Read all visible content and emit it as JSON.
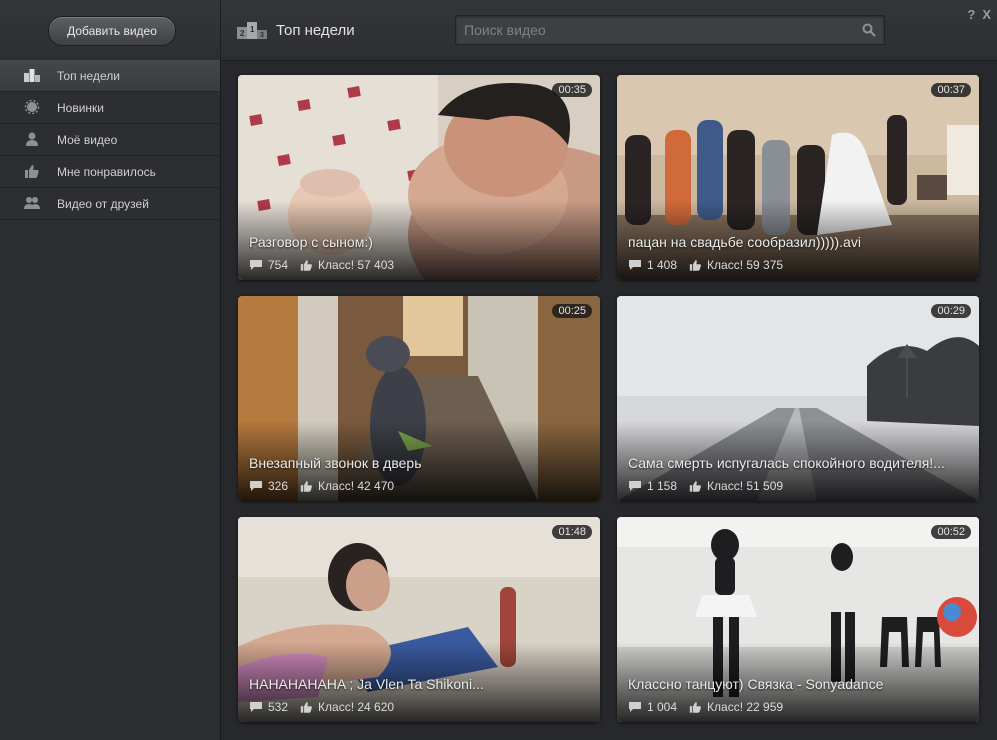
{
  "toolbar": {
    "add_video_label": "Добавить видео",
    "section_title": "Топ недели",
    "search_placeholder": "Поиск видео",
    "help_label": "?",
    "close_label": "X"
  },
  "sidebar": {
    "items": [
      {
        "label": "Топ недели",
        "icon": "podium-icon"
      },
      {
        "label": "Новинки",
        "icon": "gear-icon"
      },
      {
        "label": "Моё видео",
        "icon": "person-icon"
      },
      {
        "label": "Мне понравилось",
        "icon": "thumbs-up-icon"
      },
      {
        "label": "Видео от друзей",
        "icon": "friends-icon"
      }
    ]
  },
  "videos": [
    {
      "title": "Разговор с сыном:)",
      "duration": "00:35",
      "comments": "754",
      "likes": "Класс! 57 403"
    },
    {
      "title": "пацан на свадьбе сообразил))))).avi",
      "duration": "00:37",
      "comments": "1 408",
      "likes": "Класс! 59 375"
    },
    {
      "title": "Внезапный звонок в дверь",
      "duration": "00:25",
      "comments": "326",
      "likes": "Класс! 42 470"
    },
    {
      "title": "Сама смерть испугалась спокойного водителя!...",
      "duration": "00:29",
      "comments": "1 158",
      "likes": "Класс! 51 509"
    },
    {
      "title": "HAHAHAHAHA ; Ja Vlen Ta Shikoni...",
      "duration": "01:48",
      "comments": "532",
      "likes": "Класс! 24 620"
    },
    {
      "title": "Классно танцуют) Связка - Sonyadance",
      "duration": "00:52",
      "comments": "1 004",
      "likes": "Класс! 22 959"
    }
  ]
}
